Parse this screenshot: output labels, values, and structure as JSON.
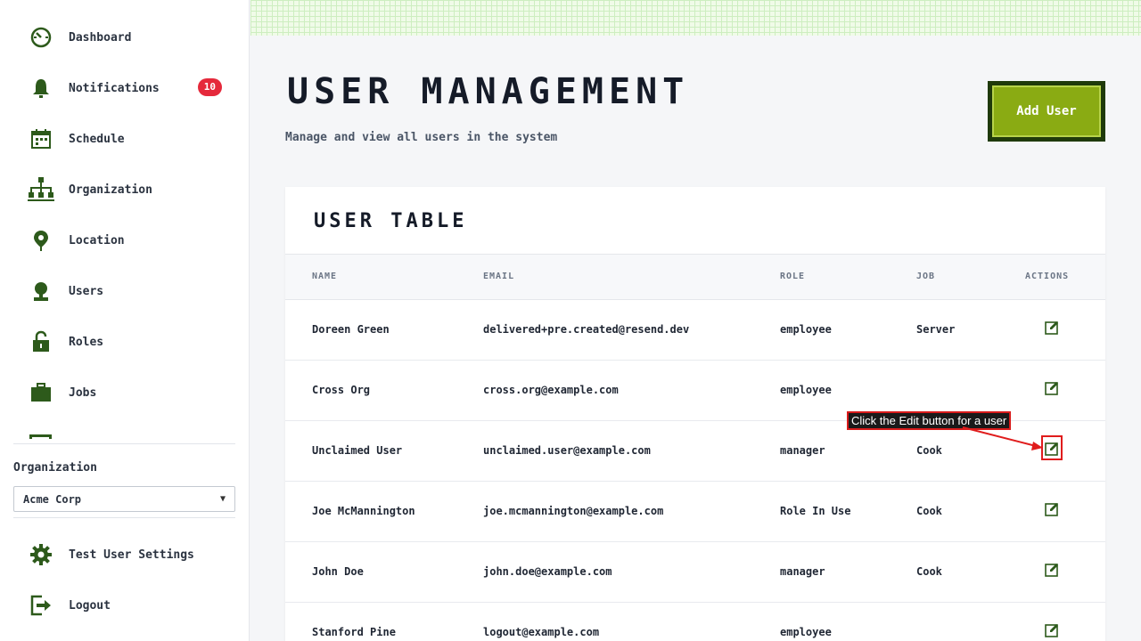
{
  "sidebar": {
    "items": [
      {
        "label": "Dashboard",
        "icon": "dashboard-icon"
      },
      {
        "label": "Notifications",
        "icon": "bell-icon",
        "badge": "10"
      },
      {
        "label": "Schedule",
        "icon": "calendar-icon"
      },
      {
        "label": "Organization",
        "icon": "org-chart-icon"
      },
      {
        "label": "Location",
        "icon": "map-pin-icon"
      },
      {
        "label": "Users",
        "icon": "user-icon"
      },
      {
        "label": "Roles",
        "icon": "lock-icon"
      },
      {
        "label": "Jobs",
        "icon": "briefcase-icon"
      }
    ],
    "org_label": "Organization",
    "org_value": "Acme Corp",
    "bottom_items": [
      {
        "label": "Test User Settings",
        "icon": "gear-icon"
      },
      {
        "label": "Logout",
        "icon": "logout-icon"
      }
    ]
  },
  "header": {
    "title": "USER MANAGEMENT",
    "subtitle": "Manage and view all users in the system",
    "add_button": "Add User"
  },
  "table": {
    "title": "USER TABLE",
    "columns": [
      "NAME",
      "EMAIL",
      "ROLE",
      "JOB",
      "ACTIONS"
    ],
    "rows": [
      {
        "name": "Doreen Green",
        "email": "delivered+pre.created@resend.dev",
        "role": "employee",
        "job": "Server"
      },
      {
        "name": "Cross Org",
        "email": "cross.org@example.com",
        "role": "employee",
        "job": ""
      },
      {
        "name": "Unclaimed User",
        "email": "unclaimed.user@example.com",
        "role": "manager",
        "job": "Cook"
      },
      {
        "name": "Joe McMannington",
        "email": "joe.mcmannington@example.com",
        "role": "Role In Use",
        "job": "Cook"
      },
      {
        "name": "John Doe",
        "email": "john.doe@example.com",
        "role": "manager",
        "job": "Cook"
      },
      {
        "name": "Stanford Pine",
        "email": "logout@example.com",
        "role": "employee",
        "job": ""
      }
    ]
  },
  "annotation": {
    "text": "Click the Edit button for a user"
  },
  "colors": {
    "accent": "#8aab13",
    "icon_green": "#2d5a1b",
    "badge_red": "#e5293b",
    "highlight_red": "#d81b1b"
  }
}
